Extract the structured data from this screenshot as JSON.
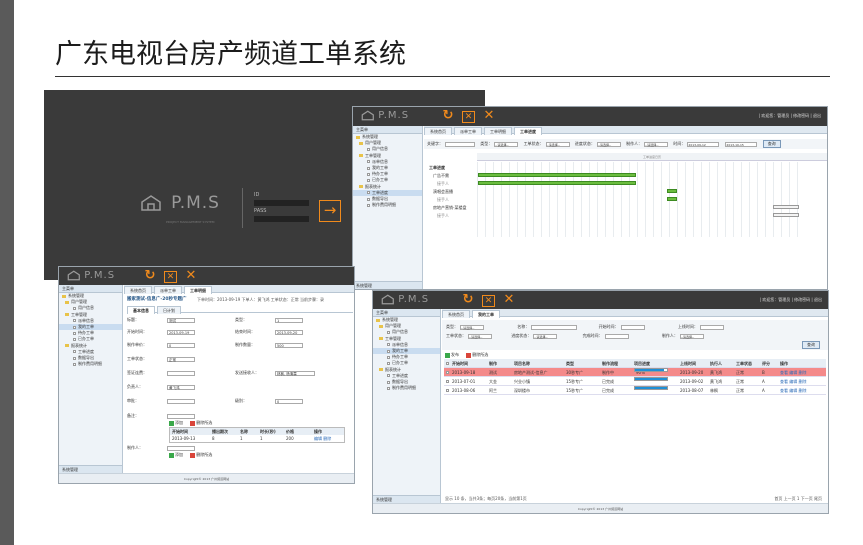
{
  "slide": {
    "title": "广东电视台房产频道工单系统"
  },
  "brand": {
    "name": "P.M.S",
    "subtitle": "PROJECT MANAGEMENT SYSTEM"
  },
  "login": {
    "id_label": "ID",
    "pass_label": "PASS",
    "submit_icon": "arrow-right-icon"
  },
  "top_links": "| 欢迎您：管理员 | 修改密码 | 退出",
  "sidebar": {
    "header": "主菜单",
    "items": [
      {
        "label": "系统管理",
        "level": 0
      },
      {
        "label": "用户管理",
        "level": 1
      },
      {
        "label": "用户信息",
        "level": 2
      },
      {
        "label": "工单管理",
        "level": 1
      },
      {
        "label": "派单信息",
        "level": 2
      },
      {
        "label": "我的工单",
        "level": 2
      },
      {
        "label": "待办工单",
        "level": 2
      },
      {
        "label": "已办工单",
        "level": 2
      },
      {
        "label": "报表统计",
        "level": 1
      },
      {
        "label": "工单进度",
        "level": 2
      },
      {
        "label": "数据导出",
        "level": 2
      },
      {
        "label": "制作费用明细",
        "level": 2
      }
    ],
    "bottom": "系统管理"
  },
  "gantt_window": {
    "tabs": [
      "系统首页",
      "派单工单",
      "工单明细",
      "工单进度"
    ],
    "active_tab": 3,
    "filter": {
      "keyword_label": "关键字：",
      "field1_label": "类型：",
      "field1_value": "--请选择--",
      "field2_label": "工单状态：",
      "field2_value": "--请选择--",
      "field3_label": "进度状态：",
      "field3_value": "--请选择--",
      "field4_label": "制作人：",
      "field4_value": "--请选择--",
      "date_label": "时间：",
      "date_from": "2013-09-12",
      "date_to": "2013-10-15",
      "search_button": "查询"
    },
    "groups": [
      {
        "title": "工单进度"
      },
      {
        "label": "广告不需",
        "sub": "接手人"
      },
      {
        "label": "演唱会直播",
        "sub": "接手人"
      },
      {
        "label": "房地产营销-某楼盘",
        "sub": "接手人"
      }
    ],
    "ruler_label": "工单进度日历"
  },
  "form_window": {
    "tabs": [
      "系统首页",
      "派单工单",
      "工单明细"
    ],
    "active_tab": 2,
    "title": "搬家测试-信息广-20秒专题广",
    "meta": "下单时间：2013-09-19   下单人：黄飞鸿   工单状态：正常   当前步骤：录",
    "subtabs": [
      "基本信息",
      "日计划"
    ],
    "fields": [
      {
        "label": "标题：",
        "value": "测试"
      },
      {
        "label": "类型：",
        "value": "1"
      },
      {
        "label": "开始时间：",
        "value": "2013-09-19"
      },
      {
        "label": "结束时间：",
        "value": "2013-09-20"
      },
      {
        "label": "制作单价：",
        "value": "0"
      },
      {
        "label": "制作数量：",
        "value": "500"
      },
      {
        "label": "工单状态：",
        "value": "正常"
      },
      {
        "label": "签证连费：",
        "value": ""
      },
      {
        "label": "发送接收人：",
        "value": "林枫, 杨清霖"
      },
      {
        "label": "负责人：",
        "value": "黄飞鸿"
      },
      {
        "label": "审批：",
        "value": ""
      },
      {
        "label": "级别：",
        "value": "0"
      },
      {
        "label": "备注：",
        "value": ""
      },
      {
        "label": "制作人：",
        "value": ""
      }
    ],
    "buttons": {
      "add": "添加",
      "delete": "删除所选"
    },
    "table": {
      "headers": [
        "开始时间",
        "播出期次",
        "名称",
        "时长(秒)",
        "价格",
        "操作"
      ],
      "rows": [
        [
          "2013-09-13",
          "8",
          "1",
          "1",
          "200",
          "编辑 删除"
        ]
      ]
    },
    "copyright": "Copyright© 2013 广州频道网站"
  },
  "list_window": {
    "tabs": [
      "系统首页",
      "我的工单"
    ],
    "active_tab": 1,
    "filter": {
      "status_label": "类型：",
      "status_value": "--请选择--",
      "name_label": "名称：",
      "start_label": "开始时间：",
      "end_label": "上线时间：",
      "type_label": "工单状态：",
      "type_value": "--请选择--",
      "progress_label": "进度状态：",
      "progress_value": "--请选择--",
      "finish_label": "完成时间：",
      "maker_label": "制作人：",
      "maker_value": "--请选择--",
      "search_button": "查询"
    },
    "buttons": {
      "add": "发布",
      "delete": "删除所选"
    },
    "table": {
      "headers": [
        "开始时间",
        "制作",
        "项目名称",
        "类型",
        "制作流程",
        "项目进度",
        "上线时间",
        "执行人",
        "工单状态",
        "评分",
        "操作"
      ],
      "rows": [
        {
          "start": "2013-09-18",
          "maker": "测试",
          "name": "房地产测试-信息广",
          "type": "30秒专广",
          "flow": "制作中",
          "progress": 0.9,
          "progress_text": "90%",
          "online": "2013-09-20",
          "owner": "黄飞鸿",
          "status": "正常",
          "score": "B",
          "ops": "查看 编辑 删除",
          "highlight": true
        },
        {
          "start": "2013-07-01",
          "maker": "大金",
          "name": "兴业小镇",
          "type": "15秒专广",
          "flow": "已完成",
          "progress": 1.0,
          "progress_text": "",
          "online": "2013-09-02",
          "owner": "黄飞鸿",
          "status": "正常",
          "score": "A",
          "ops": "查看 编辑 删除",
          "highlight": false
        },
        {
          "start": "2013-08-06",
          "maker": "阿兰",
          "name": "深圳楼市",
          "type": "15秒专广",
          "flow": "已完成",
          "progress": 1.0,
          "progress_text": "",
          "online": "2013-08-07",
          "owner": "林枫",
          "status": "正常",
          "score": "A",
          "ops": "查看 编辑 删除",
          "highlight": false
        }
      ]
    },
    "pager": "显示 10 条，当共3条；每页20条，当前第1页",
    "pager_right": "首页 上一页 1 下一页 尾页",
    "copyright": "Copyright© 2013 广州频道网站"
  }
}
